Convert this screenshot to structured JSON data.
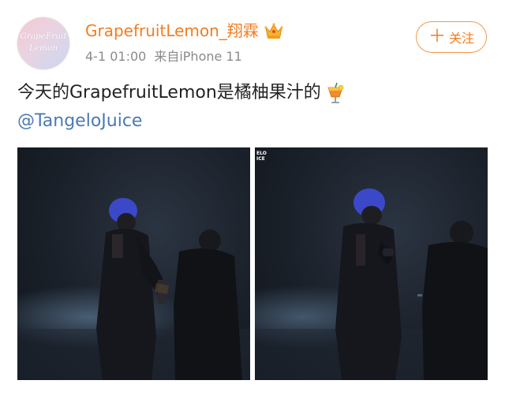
{
  "post": {
    "author": {
      "name": "GrapefruitLemon_翔霖",
      "avatar_text_line1": "GrapeFruit",
      "avatar_text_line2": "Lemon",
      "badge_icon": "crown-icon",
      "name_color": "#f47c1e"
    },
    "meta": {
      "time": "4-1 01:00",
      "source": "来自iPhone 11"
    },
    "follow_button": {
      "icon": "＋",
      "label": "关注"
    },
    "text": "今天的GrapefruitLemon是橘柚果汁的",
    "text_emoji": "drink-icon",
    "mention": "@TangeloJuice",
    "images": [
      {
        "watermark": ""
      },
      {
        "watermark_line1": "ELO",
        "watermark_line2": "ICE"
      }
    ]
  },
  "colors": {
    "accent": "#f47c1e",
    "link": "#4a7ab5",
    "meta": "#8a8a8a"
  }
}
